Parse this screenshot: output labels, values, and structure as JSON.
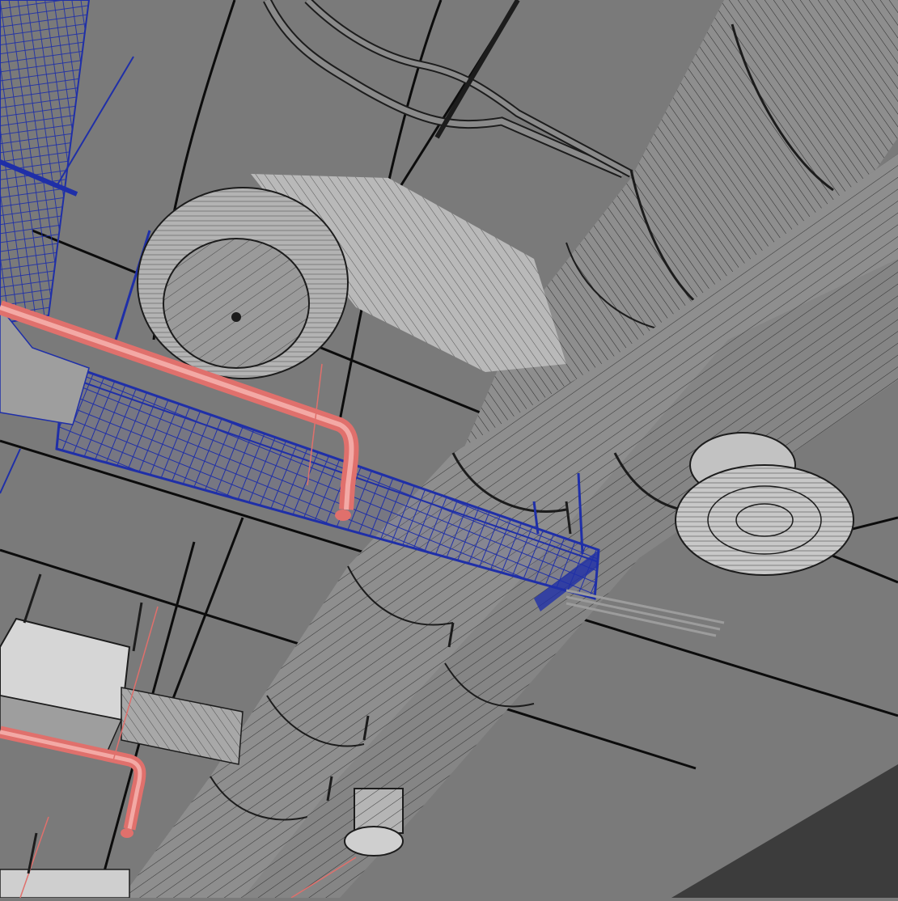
{
  "scene": {
    "view": "wireframe-shaded",
    "colors": {
      "ceiling": "#7a7a7a",
      "wall_shadow": "#3c3c3c",
      "duct_fill": "#8e8e8e",
      "duct_fill_light": "#b9b9b9",
      "wire": "#1c1c1c",
      "cable_tray": "#1f2fa8",
      "sprinkler_pipe": "#e0706c",
      "beam_line": "#0c0c0c",
      "box_fill": "#d6d6d6"
    },
    "objects": [
      {
        "name": "main-duct-upper",
        "kind": "round-duct"
      },
      {
        "name": "main-duct-lower",
        "kind": "round-duct"
      },
      {
        "name": "duct-elbow-diffuser-left",
        "kind": "round-duct-elbow"
      },
      {
        "name": "ceiling-diffuser-right",
        "kind": "round-diffuser"
      },
      {
        "name": "ceiling-diffuser-bottom",
        "kind": "round-diffuser"
      },
      {
        "name": "cable-tray-wire-mesh",
        "kind": "wire-mesh-tray"
      },
      {
        "name": "sprinkler-pipe-upper",
        "kind": "pipe"
      },
      {
        "name": "sprinkler-pipe-lower",
        "kind": "pipe"
      },
      {
        "name": "junction-box",
        "kind": "box"
      },
      {
        "name": "conduit-upper",
        "kind": "conduit"
      }
    ]
  }
}
